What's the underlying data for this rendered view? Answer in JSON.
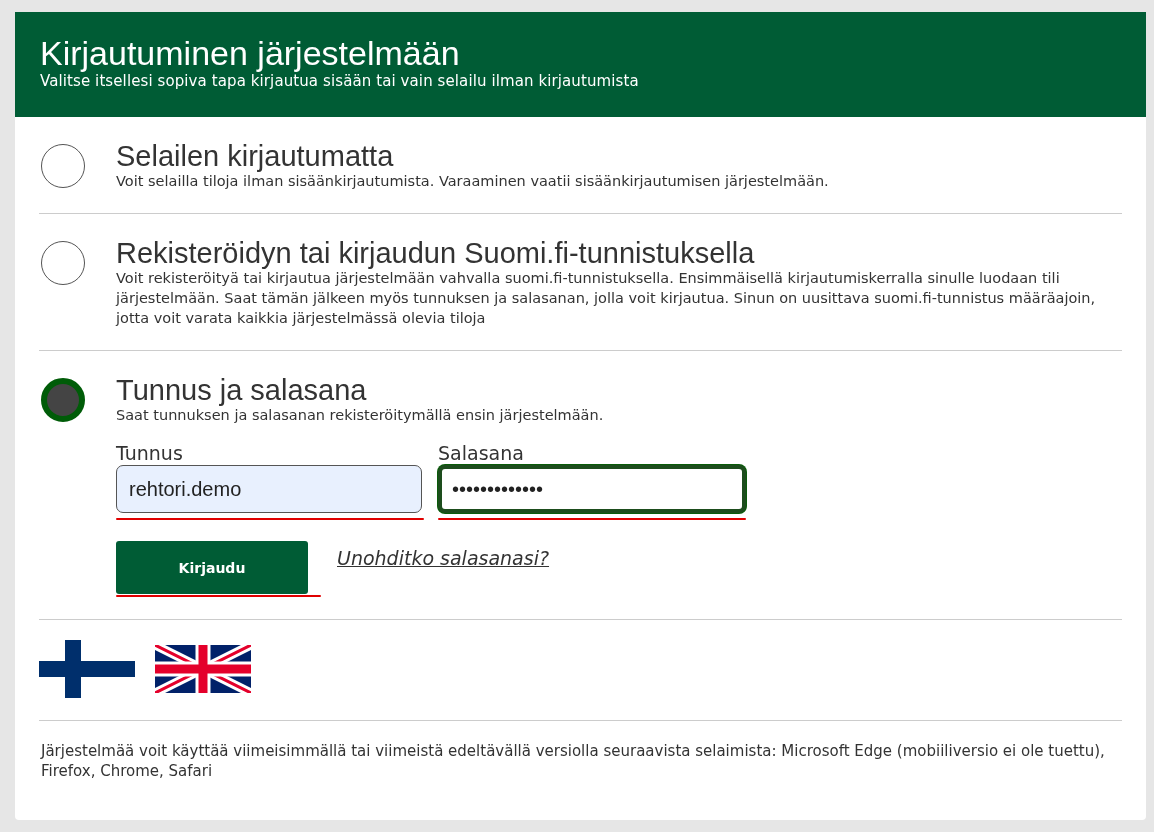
{
  "header": {
    "title": "Kirjautuminen järjestelmään",
    "subtitle": "Valitse itsellesi sopiva tapa kirjautua sisään tai vain selailu ilman kirjautumista"
  },
  "options": [
    {
      "title": "Selailen kirjautumatta",
      "description": "Voit selailla tiloja ilman sisäänkirjautumista. Varaaminen vaatii sisäänkirjautumisen järjestelmään.",
      "selected": false
    },
    {
      "title": "Rekisteröidyn tai kirjaudun Suomi.fi-tunnistuksella",
      "description": "Voit rekisteröityä tai kirjautua järjestelmään vahvalla suomi.fi-tunnistuksella. Ensimmäisellä kirjautumiskerralla sinulle luodaan tili järjestelmään. Saat tämän jälkeen myös tunnuksen ja salasanan, jolla voit kirjautua. Sinun on uusittava suomi.fi-tunnistus määräajoin, jotta voit varata kaikkia järjestelmässä olevia tiloja",
      "selected": false
    },
    {
      "title": "Tunnus ja salasana",
      "description": "Saat tunnuksen ja salasanan rekisteröitymällä ensin järjestelmään.",
      "selected": true,
      "login_form": {
        "fields": [
          {
            "label": "Tunnus",
            "value": "rehtori.demo",
            "autofilled": true,
            "focused": false,
            "marked": true
          },
          {
            "label": "Salasana",
            "value": "•••••••••••••",
            "autofilled": false,
            "focused": true,
            "marked": true
          }
        ],
        "submit_button": {
          "label": "Kirjaudu",
          "marked": true
        },
        "forgot_link": "Unohditko salasanasi?"
      }
    }
  ],
  "languages": [
    {
      "kind": "fi"
    },
    {
      "kind": "en"
    }
  ],
  "footer": "Järjestelmää voit käyttää viimeisimmällä tai viimeistä edeltävällä versiolla seuraavista selaimista: Microsoft Edge (mobiiliversio ei ole tuettu), Firefox, Chrome, Safari"
}
